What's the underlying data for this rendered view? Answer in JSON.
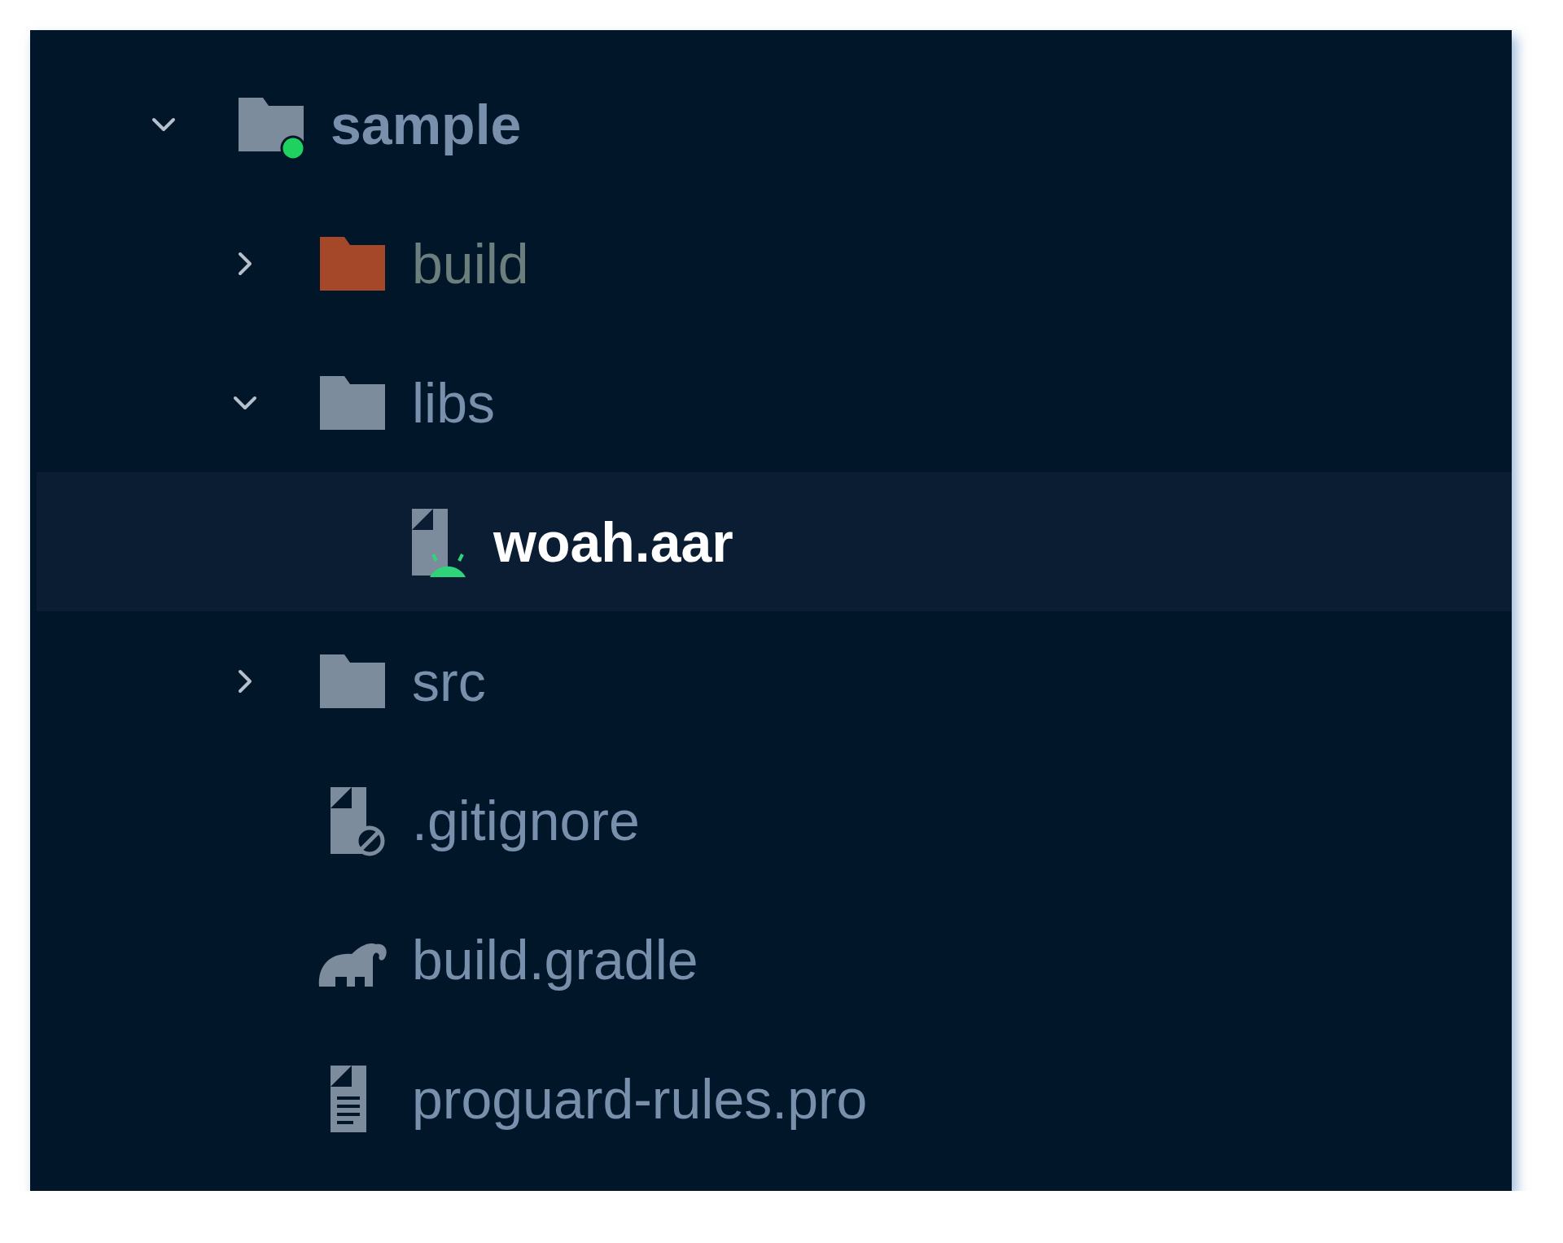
{
  "tree": [
    {
      "name": "sample",
      "kind": "module",
      "expanded": true,
      "selected": false,
      "children": [
        {
          "name": "build",
          "kind": "excluded-folder",
          "expanded": false,
          "selected": false
        },
        {
          "name": "libs",
          "kind": "folder",
          "expanded": true,
          "selected": false,
          "children": [
            {
              "name": "woah.aar",
              "kind": "aar",
              "selected": true
            }
          ]
        },
        {
          "name": "src",
          "kind": "folder",
          "expanded": false,
          "selected": false
        },
        {
          "name": ".gitignore",
          "kind": "ignored-file",
          "selected": false
        },
        {
          "name": "build.gradle",
          "kind": "gradle",
          "selected": false
        },
        {
          "name": "proguard-rules.pro",
          "kind": "text-file",
          "selected": false
        }
      ]
    }
  ]
}
